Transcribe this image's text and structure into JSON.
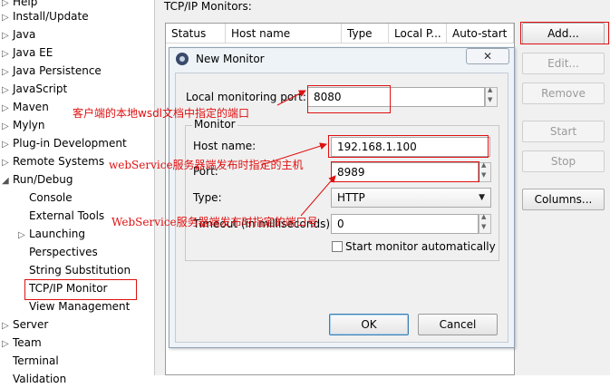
{
  "tree": {
    "items": [
      {
        "label": "Help",
        "expandable": true
      },
      {
        "label": "Install/Update",
        "expandable": true
      },
      {
        "label": "Java",
        "expandable": true
      },
      {
        "label": "Java EE",
        "expandable": true
      },
      {
        "label": "Java Persistence",
        "expandable": true
      },
      {
        "label": "JavaScript",
        "expandable": true
      },
      {
        "label": "Maven",
        "expandable": true
      },
      {
        "label": "Mylyn",
        "expandable": true
      },
      {
        "label": "Plug-in Development",
        "expandable": true
      },
      {
        "label": "Remote Systems",
        "expandable": true
      },
      {
        "label": "Run/Debug",
        "expandable": true,
        "expanded": true
      },
      {
        "label": "Console",
        "child": true
      },
      {
        "label": "External Tools",
        "child": true
      },
      {
        "label": "Launching",
        "child": true,
        "expandable": true
      },
      {
        "label": "Perspectives",
        "child": true
      },
      {
        "label": "String Substitution",
        "child": true
      },
      {
        "label": "TCP/IP Monitor",
        "child": true,
        "selected": true
      },
      {
        "label": "View Management",
        "child": true
      },
      {
        "label": "Server",
        "expandable": true
      },
      {
        "label": "Team",
        "expandable": true
      },
      {
        "label": "Terminal",
        "expandable": false
      },
      {
        "label": "Validation",
        "expandable": false
      }
    ]
  },
  "page": {
    "title": "TCP/IP Monitors:",
    "columns": [
      "Status",
      "Host name",
      "Type",
      "Local P...",
      "Auto-start"
    ]
  },
  "buttons": {
    "add": "Add...",
    "edit": "Edit...",
    "remove": "Remove",
    "start": "Start",
    "stop": "Stop",
    "columns": "Columns..."
  },
  "dialog": {
    "title": "New Monitor",
    "local_port_label": "Local monitoring port:",
    "local_port_value": "8080",
    "group_label": "Monitor",
    "host_label": "Host name:",
    "host_value": "192.168.1.100",
    "port_label": "Port:",
    "port_value": "8989",
    "type_label": "Type:",
    "type_value": "HTTP",
    "timeout_label": "Timeout (in milliseconds):",
    "timeout_value": "0",
    "autostart_label": "Start monitor automatically",
    "autostart_checked": false,
    "ok": "OK",
    "cancel": "Cancel"
  },
  "annotations": {
    "local_port_note": "客户端的本地wsdl文档中指定的端口",
    "host_note": "webService服务器端发布时指定的主机",
    "port_note": "WebService服务器端发布时指定的端口号",
    "color": "#e01010"
  }
}
